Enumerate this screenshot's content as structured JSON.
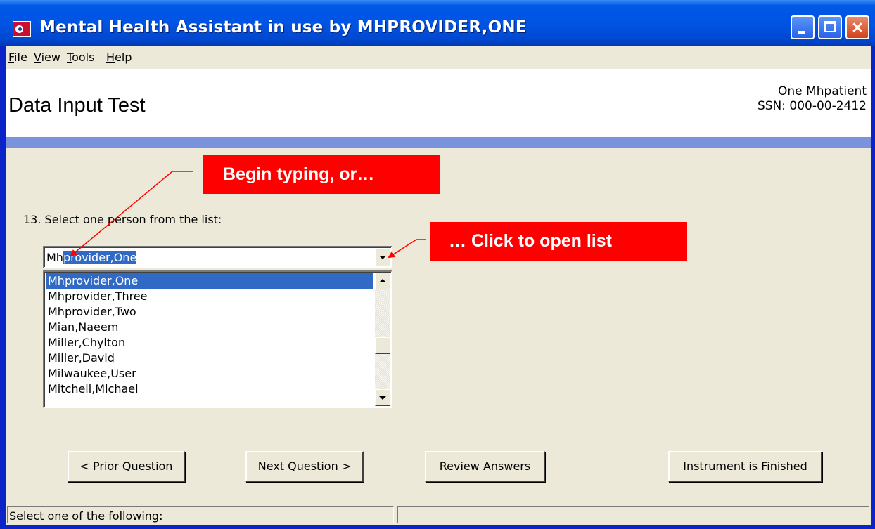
{
  "window": {
    "title": "Mental Health Assistant in use by MHPROVIDER,ONE"
  },
  "menu": {
    "items": [
      {
        "pre": "",
        "key": "F",
        "post": "ile"
      },
      {
        "pre": "",
        "key": "V",
        "post": "iew"
      },
      {
        "pre": "",
        "key": "T",
        "post": "ools"
      },
      {
        "pre": "",
        "key": "H",
        "post": "elp"
      }
    ]
  },
  "header": {
    "page_title": "Data Input Test",
    "patient_name": "One Mhpatient",
    "patient_ssn": "SSN: 000-00-2412"
  },
  "question": {
    "text": "13. Select one person from the list:"
  },
  "combo": {
    "typed": "Mh",
    "autocompleted": "provider,One"
  },
  "list": {
    "items": [
      "Mhprovider,One",
      "Mhprovider,Three",
      "Mhprovider,Two",
      "Mian,Naeem",
      "Miller,Chylton",
      "Miller,David",
      "Milwaukee,User",
      "Mitchell,Michael"
    ],
    "selected_index": 0
  },
  "callouts": {
    "typing": "Begin typing, or…",
    "open_list": "… Click to open list"
  },
  "buttons": {
    "prior": {
      "pre": "< ",
      "key": "P",
      "post": "rior Question"
    },
    "next": {
      "pre": "Next ",
      "key": "Q",
      "post": "uestion >"
    },
    "review": {
      "pre": "",
      "key": "R",
      "post": "eview Answers"
    },
    "finish": {
      "pre": "",
      "key": "I",
      "post": "nstrument is Finished"
    }
  },
  "status": {
    "message": "Select one of the following:",
    "secondary": ""
  },
  "colors": {
    "callout": "#ff0000",
    "selection": "#316ac5",
    "band": "#7b93dc",
    "face": "#ece9d8"
  }
}
